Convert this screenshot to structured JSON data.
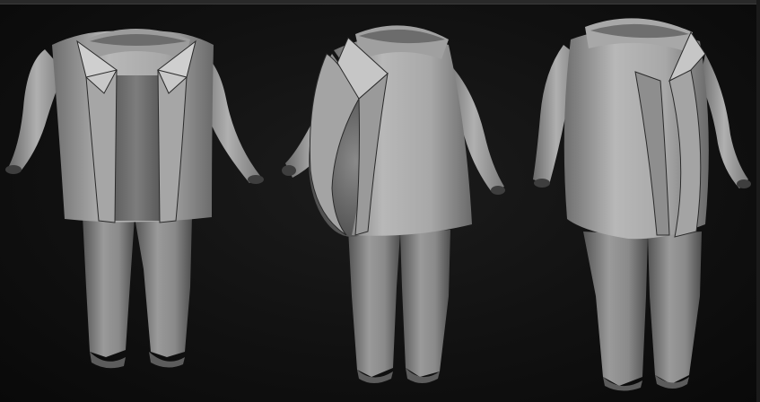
{
  "scene": {
    "description_hidden": "",
    "figures": [
      {
        "view": "front"
      },
      {
        "view": "three-quarter"
      },
      {
        "view": "side-front"
      }
    ],
    "colors": {
      "background": "#0b0b0b",
      "clay_light": "#bdbdbd",
      "clay_mid": "#8d8d8d",
      "clay_dark": "#5a5a5a",
      "shirt": "#777777",
      "pants": "#8a8a8a"
    }
  }
}
